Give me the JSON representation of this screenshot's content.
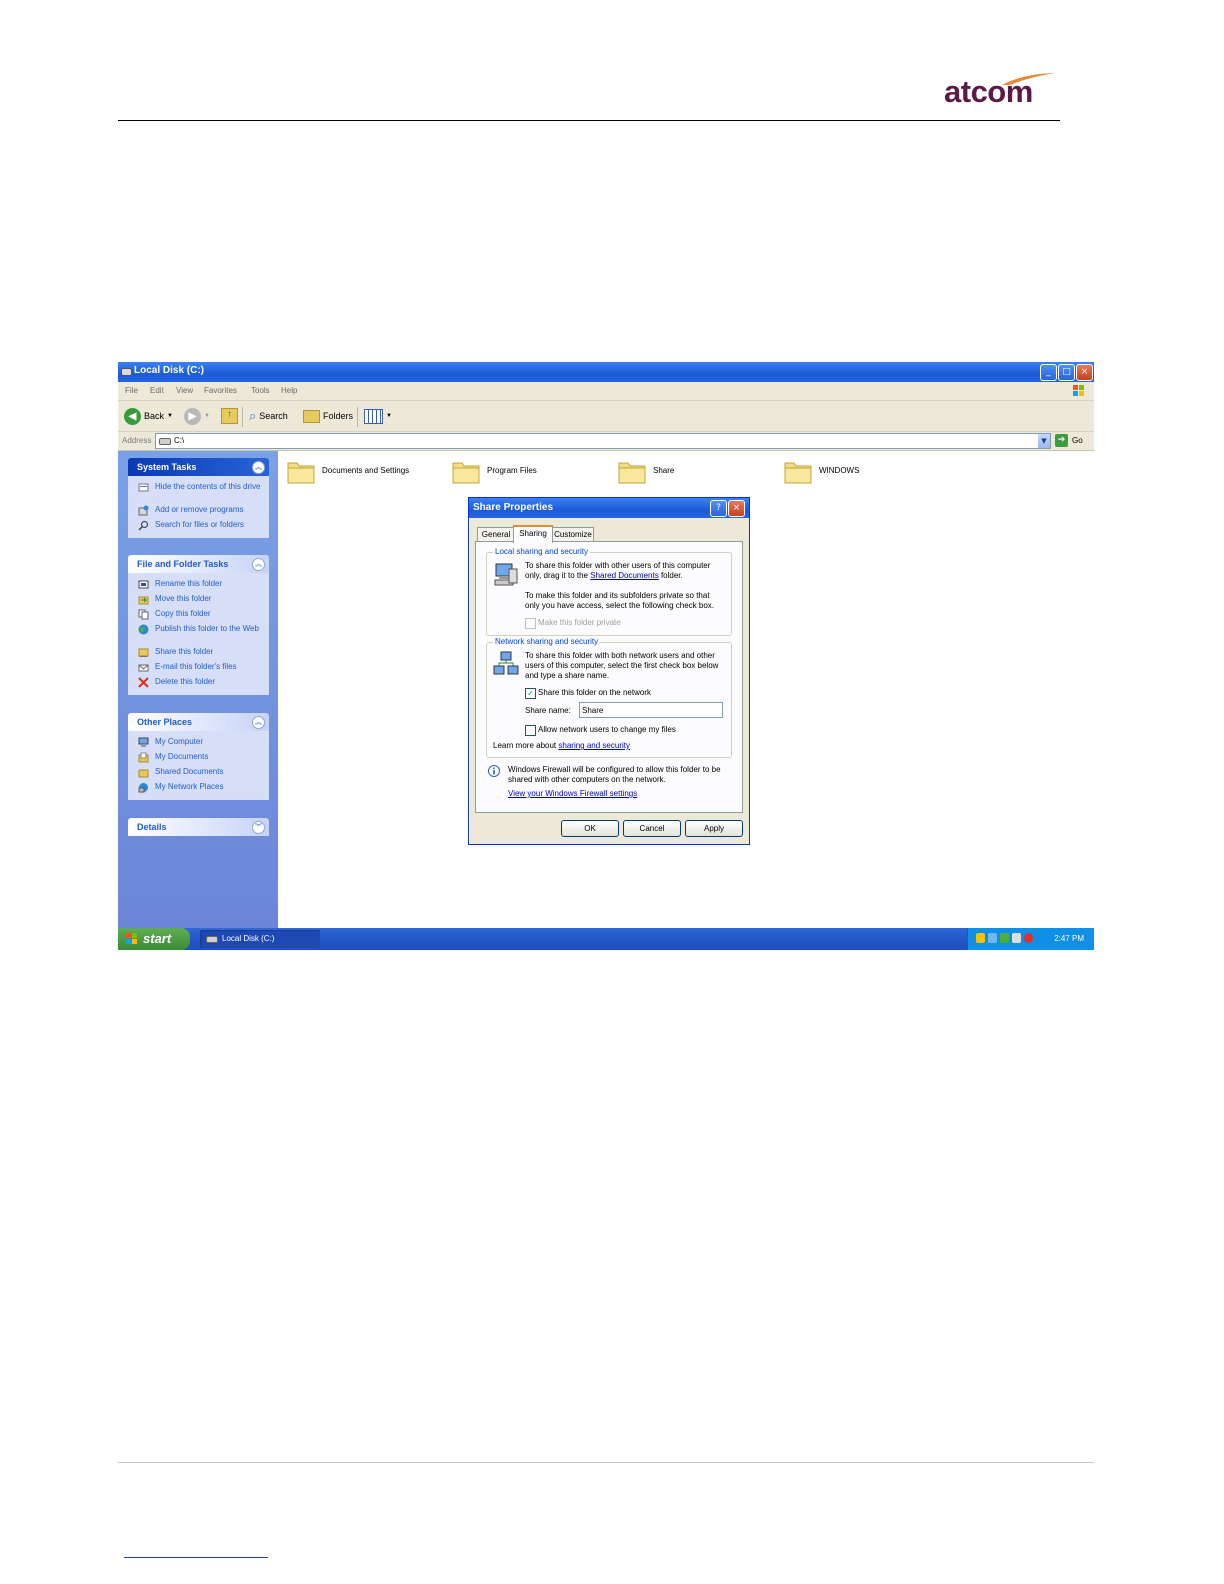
{
  "brand": {
    "name": "atcom",
    "text_color": "#5b1a46",
    "swoosh_color": "#e8893a"
  },
  "window": {
    "title": "Local Disk (C:)",
    "controls": {
      "minimize": "_",
      "maximize": "□",
      "close": "×"
    },
    "menu": [
      "File",
      "Edit",
      "View",
      "Favorites",
      "Tools",
      "Help"
    ],
    "toolbar": {
      "back": "Back",
      "search": "Search",
      "folders": "Folders"
    },
    "address": {
      "label": "Address",
      "value": "C:\\",
      "go": "Go"
    }
  },
  "left_pane": {
    "system_tasks": {
      "title": "System Tasks",
      "items": [
        "Hide the contents of this drive",
        "Add or remove programs",
        "Search for files or folders"
      ]
    },
    "file_folder_tasks": {
      "title": "File and Folder Tasks",
      "items": [
        "Rename this folder",
        "Move this folder",
        "Copy this folder",
        "Publish this folder to the Web",
        "Share this folder",
        "E-mail this folder's files",
        "Delete this folder"
      ]
    },
    "other_places": {
      "title": "Other Places",
      "items": [
        "My Computer",
        "My Documents",
        "Shared Documents",
        "My Network Places"
      ]
    },
    "details": {
      "title": "Details"
    }
  },
  "folders": [
    "Documents and Settings",
    "Program Files",
    "Share",
    "WINDOWS"
  ],
  "dialog": {
    "title": "Share Properties",
    "help": "?",
    "close": "×",
    "tabs": [
      "General",
      "Sharing",
      "Customize"
    ],
    "local": {
      "label": "Local sharing and security",
      "text1_pre": "To share this folder with other users of this computer only, drag it to the",
      "text1_link": "Shared Documents",
      "text1_post": "folder.",
      "text2": "To make this folder and its subfolders private so that only you have access, select the following check box.",
      "make_private": "Make this folder private"
    },
    "network": {
      "label": "Network sharing and security",
      "text": "To share this folder with both network users and other users of this computer, select the first check box below and type a share name.",
      "share_on_network": "Share this folder on the network",
      "share_name_label": "Share name:",
      "share_name_value": "Share",
      "allow_change": "Allow network users to change my files",
      "learn_pre": "Learn more about",
      "learn_link": "sharing and security"
    },
    "firewall": {
      "text": "Windows Firewall will be configured to allow this folder to be shared with other computers on the network.",
      "link": "View your Windows Firewall settings"
    },
    "buttons": {
      "ok": "OK",
      "cancel": "Cancel",
      "apply": "Apply"
    }
  },
  "taskbar": {
    "start": "start",
    "task": "Local Disk (C:)",
    "clock": "2:47 PM"
  }
}
